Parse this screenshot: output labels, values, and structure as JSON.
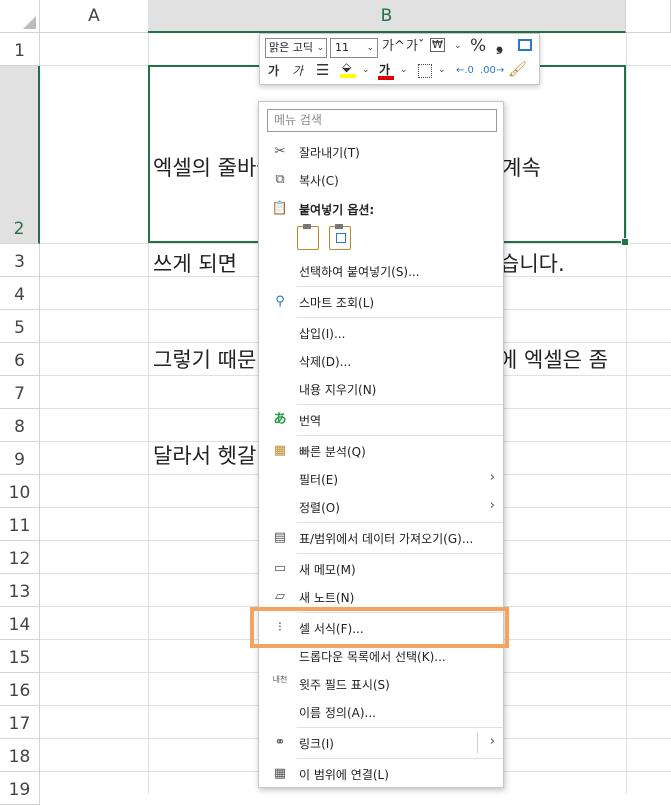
{
  "columns": [
    "A",
    "B"
  ],
  "rows": [
    "1",
    "2",
    "3",
    "4",
    "5",
    "6",
    "7",
    "8",
    "9",
    "10",
    "11",
    "12",
    "13",
    "14",
    "15",
    "16",
    "17",
    "18",
    "19"
  ],
  "cell_text": "엑셀의 줄바꿈이 필요한 이유는 한 줄로 계속\n쓰게 되면 (hidden) 가독성이 떨어지기 때문입니다.\n그렇기 때문에 (hidden) 해야하는데 엑셀은 좀\n달라서 헷갈 (hidden)",
  "cell_lines": [
    "엑셀의 줄바꿈이 필요한 이유는 한 줄로 계속",
    "쓰게 되면",
    "그렇기 때문",
    "달라서 헷갈"
  ],
  "cell_lines_right": [
    "",
    "습니다.",
    "에 엑셀은 좀",
    ""
  ],
  "mini_toolbar": {
    "font_name": "맑은 고딕",
    "font_size": "11",
    "grow": "가^",
    "shrink": "가ˇ",
    "percent": "%",
    "comma": "❟",
    "bold": "가",
    "italic": "가",
    "font_color_label": "가"
  },
  "menu": {
    "search_placeholder": "메뉴 검색",
    "items": [
      {
        "label": "잘라내기(T)",
        "icon": "scissors-icon"
      },
      {
        "label": "복사(C)",
        "icon": "copy-icon"
      },
      {
        "label": "붙여넣기 옵션:",
        "icon": "paste-icon"
      },
      {
        "label": "선택하여 붙여넣기(S)...",
        "icon": ""
      },
      {
        "label": "스마트 조회(L)",
        "icon": "search-icon"
      },
      {
        "label": "삽입(I)...",
        "icon": ""
      },
      {
        "label": "삭제(D)...",
        "icon": ""
      },
      {
        "label": "내용 지우기(N)",
        "icon": ""
      },
      {
        "label": "번역",
        "icon": "translate-icon"
      },
      {
        "label": "빠른 분석(Q)",
        "icon": "quick-analysis-icon"
      },
      {
        "label": "필터(E)",
        "icon": ""
      },
      {
        "label": "정렬(O)",
        "icon": ""
      },
      {
        "label": "표/범위에서 데이터 가져오기(G)...",
        "icon": "table-icon"
      },
      {
        "label": "새 메모(M)",
        "icon": "comment-icon"
      },
      {
        "label": "새 노트(N)",
        "icon": "note-icon"
      },
      {
        "label": "셀 서식(F)...",
        "icon": "format-cells-icon"
      },
      {
        "label": "드롭다운 목록에서 선택(K)...",
        "icon": ""
      },
      {
        "label": "윗주 필드 표시(S)",
        "icon": "phonetic-icon"
      },
      {
        "label": "이름 정의(A)...",
        "icon": ""
      },
      {
        "label": "링크(I)",
        "icon": "link-icon"
      },
      {
        "label": "이 범위에 연결(L)",
        "icon": "link-range-icon"
      }
    ],
    "phonetic_icon_text": "내천"
  },
  "colors": {
    "accent": "#217346",
    "highlight": "#f4a460"
  }
}
